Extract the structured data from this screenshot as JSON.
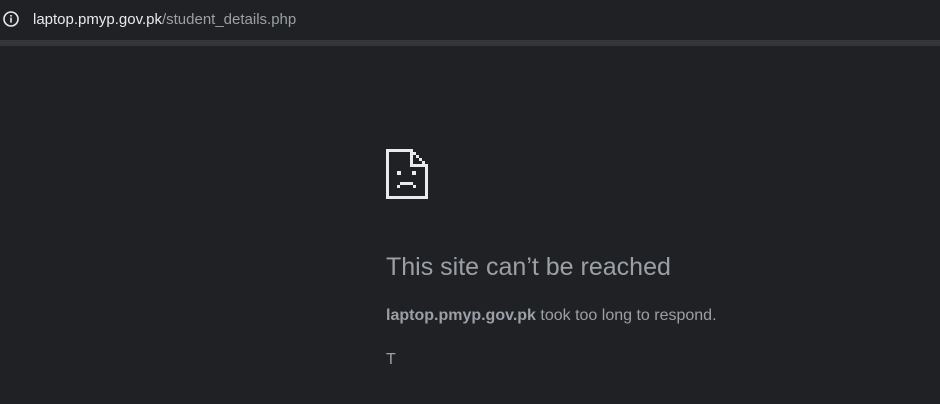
{
  "browser": {
    "url_host": "laptop.pmyp.gov.pk",
    "url_path": "/student_details.php",
    "info_icon": "info-icon"
  },
  "error": {
    "icon": "sad-page-icon",
    "title": "This site can’t be reached",
    "host": "laptop.pmyp.gov.pk",
    "message": " took too long to respond.",
    "next_line": "T"
  },
  "colors": {
    "background": "#202124",
    "toolbar_divider": "#35363a",
    "url_host": "#e8eaed",
    "muted_text": "#9aa0a6"
  }
}
